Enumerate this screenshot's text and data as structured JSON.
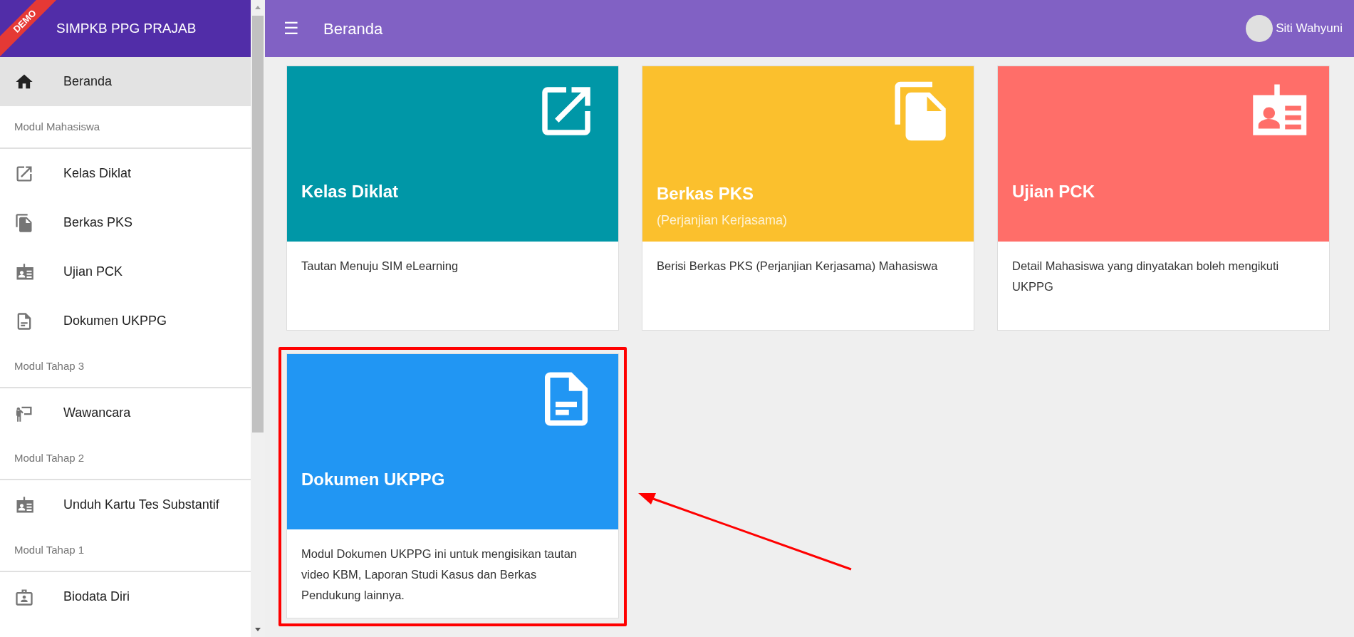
{
  "sidebar": {
    "brand": "SIMPKB PPG PRAJAB",
    "ribbon": "DEMO",
    "items": [
      {
        "kind": "item",
        "label": "Beranda",
        "selected": true
      },
      {
        "kind": "section",
        "label": "Modul Mahasiswa"
      },
      {
        "kind": "item",
        "label": "Kelas Diklat",
        "selected": false
      },
      {
        "kind": "item",
        "label": "Berkas PKS",
        "selected": false
      },
      {
        "kind": "item",
        "label": "Ujian PCK",
        "selected": false
      },
      {
        "kind": "item",
        "label": "Dokumen UKPPG",
        "selected": false
      },
      {
        "kind": "section",
        "label": "Modul Tahap 3"
      },
      {
        "kind": "item",
        "label": "Wawancara",
        "selected": false
      },
      {
        "kind": "section",
        "label": "Modul Tahap 2"
      },
      {
        "kind": "item",
        "label": "Unduh Kartu Tes Substantif",
        "selected": false
      },
      {
        "kind": "section",
        "label": "Modul Tahap 1"
      },
      {
        "kind": "item",
        "label": "Biodata Diri",
        "selected": false
      }
    ]
  },
  "header": {
    "menu": "☰",
    "title": "Beranda",
    "user": "Siti Wahyuni"
  },
  "cards": [
    {
      "title": "Kelas Diklat",
      "color": "#0097a7",
      "description": "Tautan Menuju SIM eLearning",
      "highlighted": false
    },
    {
      "title": "Berkas PKS",
      "subtitle": "(Perjanjian Kerjasama)",
      "color": "#fbc02d",
      "description": "Berisi Berkas PKS (Perjanjian Kerjasama) Mahasiswa",
      "highlighted": false
    },
    {
      "title": "Ujian PCK",
      "color": "#ff6e69",
      "description": "Detail Mahasiswa yang dinyatakan boleh mengikuti UKPPG",
      "highlighted": false
    },
    {
      "title": "Dokumen UKPPG",
      "color": "#2196f3",
      "description": "Modul Dokumen UKPPG ini untuk mengisikan tautan video KBM, Laporan Studi Kasus dan Berkas Pendukung lainnya.",
      "highlighted": true
    }
  ]
}
